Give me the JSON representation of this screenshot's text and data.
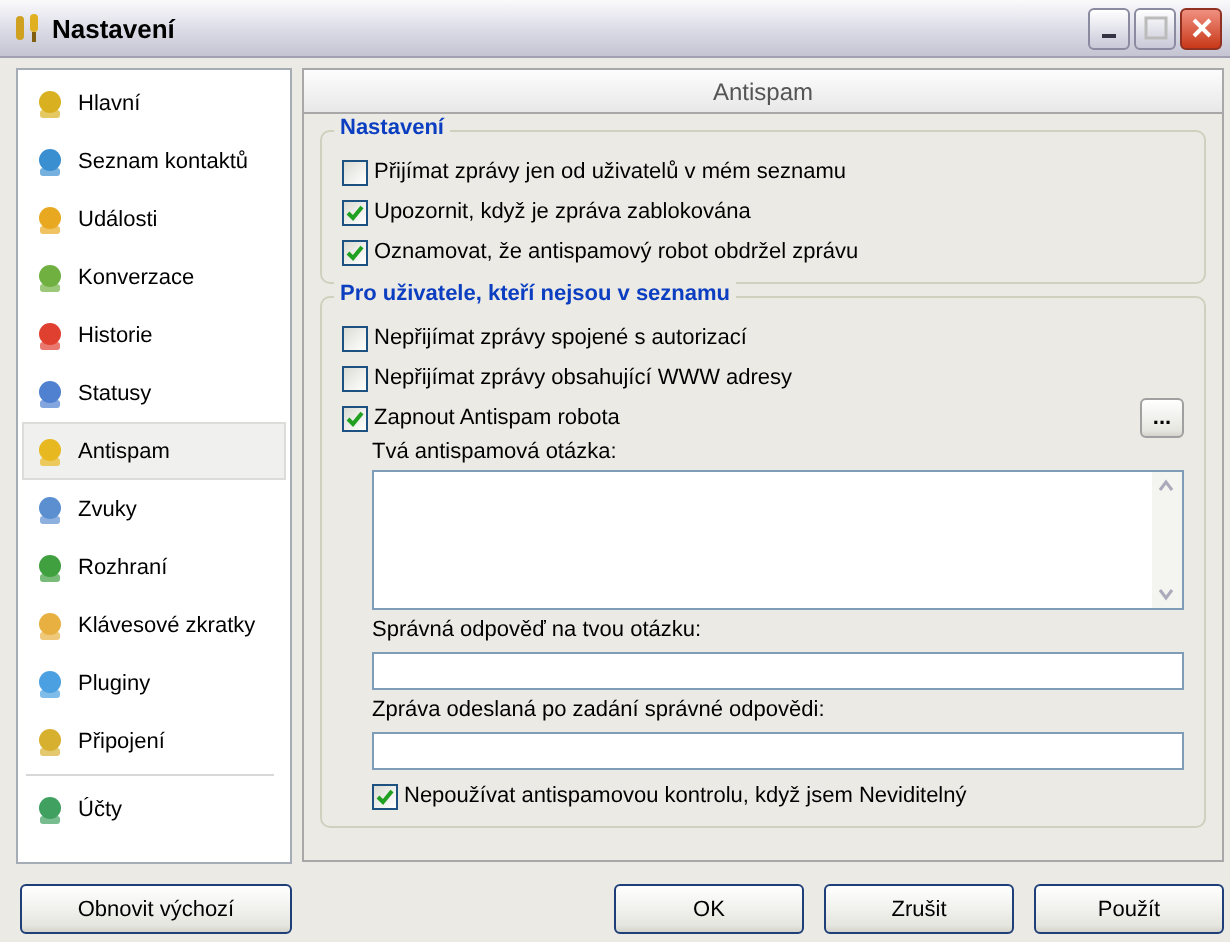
{
  "window": {
    "title": "Nastavení"
  },
  "sidebar": {
    "items": [
      {
        "label": "Hlavní",
        "selected": false,
        "divider_before": false
      },
      {
        "label": "Seznam kontaktů",
        "selected": false,
        "divider_before": false
      },
      {
        "label": "Události",
        "selected": false,
        "divider_before": false
      },
      {
        "label": "Konverzace",
        "selected": false,
        "divider_before": false
      },
      {
        "label": "Historie",
        "selected": false,
        "divider_before": false
      },
      {
        "label": "Statusy",
        "selected": false,
        "divider_before": false
      },
      {
        "label": "Antispam",
        "selected": true,
        "divider_before": false
      },
      {
        "label": "Zvuky",
        "selected": false,
        "divider_before": false
      },
      {
        "label": "Rozhraní",
        "selected": false,
        "divider_before": false
      },
      {
        "label": "Klávesové zkratky",
        "selected": false,
        "divider_before": false
      },
      {
        "label": "Pluginy",
        "selected": false,
        "divider_before": false
      },
      {
        "label": "Připojení",
        "selected": false,
        "divider_before": false
      },
      {
        "label": "Účty",
        "selected": false,
        "divider_before": true
      }
    ]
  },
  "reset_button": "Obnovit výchozí",
  "panel_title": "Antispam",
  "groups": [
    {
      "title": "Nastavení",
      "items": [
        {
          "kind": "checkbox",
          "label": "Přijímat zprávy jen od uživatelů v mém seznamu",
          "checked": false
        },
        {
          "kind": "checkbox",
          "label": "Upozornit, když je zpráva zablokována",
          "checked": true
        },
        {
          "kind": "checkbox",
          "label": "Oznamovat, že antispamový robot obdržel zprávu",
          "checked": true
        }
      ]
    },
    {
      "title": "Pro uživatele, kteří nejsou v seznamu",
      "items": [
        {
          "kind": "checkbox",
          "label": "Nepřijímat zprávy spojené s autorizací",
          "checked": false
        },
        {
          "kind": "checkbox",
          "label": "Nepřijímat zprávy obsahující WWW adresy",
          "checked": false
        },
        {
          "kind": "checkbox",
          "label": "Zapnout Antispam robota",
          "checked": true,
          "button": "...",
          "children": [
            {
              "kind": "textarea",
              "label": "Tvá antispamová otázka:"
            },
            {
              "kind": "field",
              "label": "Správná odpověď na tvou otázku:"
            },
            {
              "kind": "field",
              "label": "Zpráva odeslaná po zadání správné odpovědi:"
            },
            {
              "kind": "checkbox",
              "label": "Nepoužívat antispamovou kontrolu, když jsem Neviditelný",
              "checked": true
            }
          ]
        }
      ]
    }
  ],
  "buttons": [
    "OK",
    "Zrušit",
    "Použít"
  ]
}
